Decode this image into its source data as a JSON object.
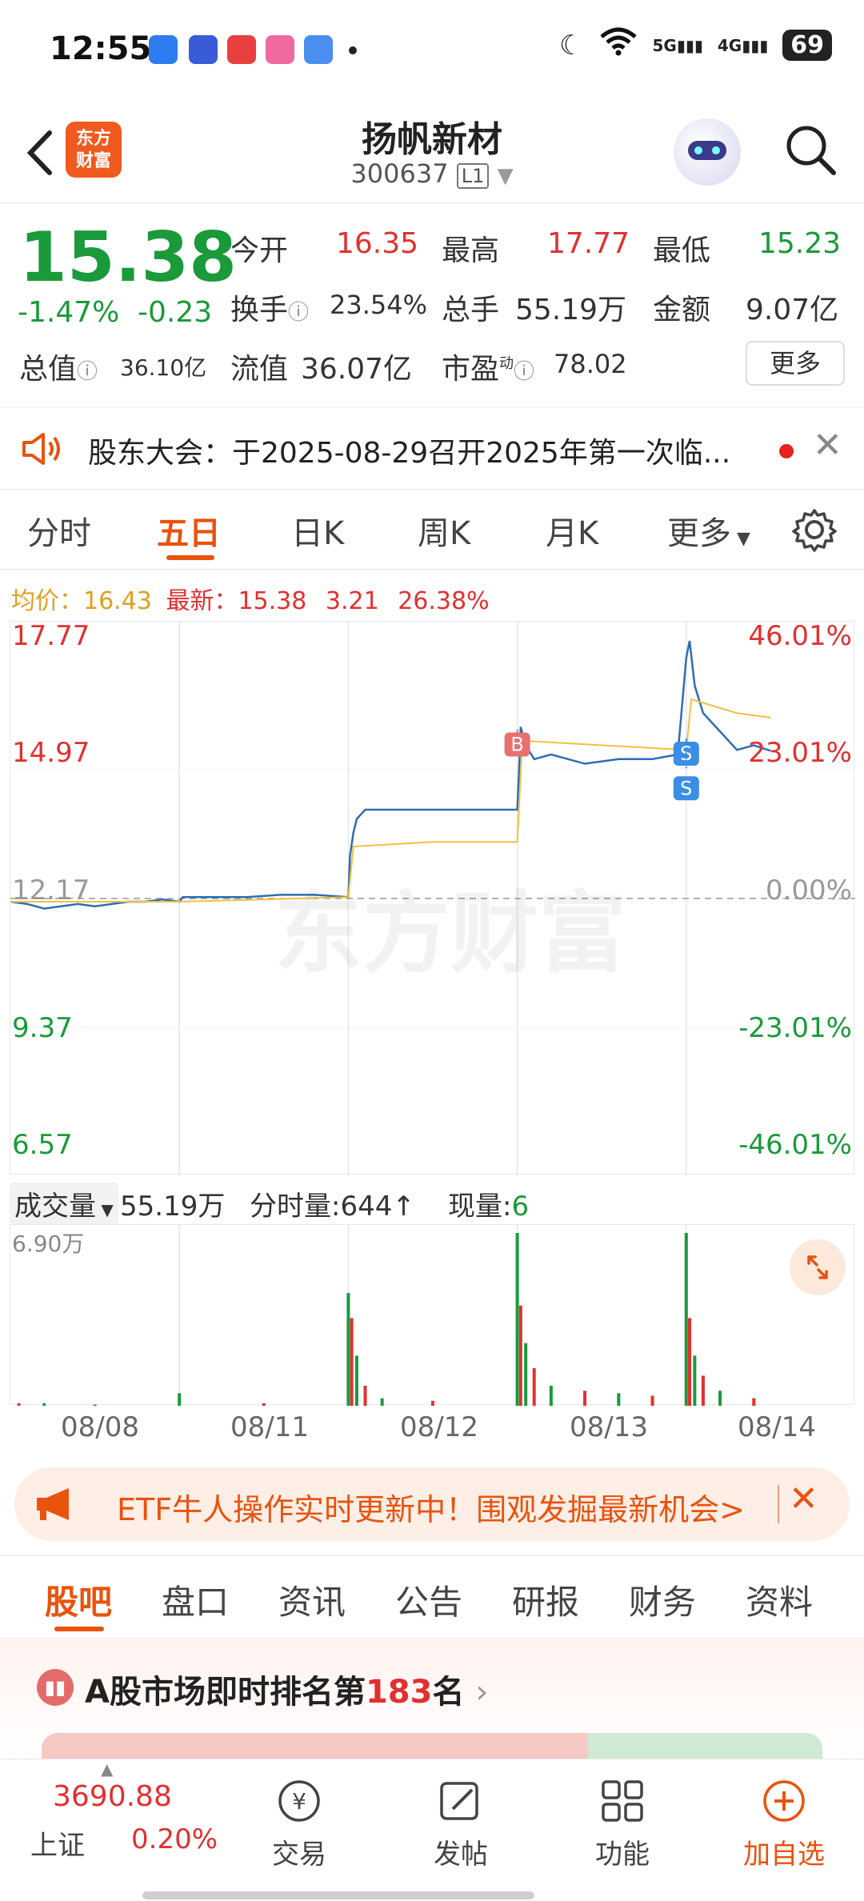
{
  "status_bar": {
    "time": "12:55",
    "battery": "69",
    "network_5g": "5G",
    "network_4g": "4G"
  },
  "header": {
    "logo_text_line1": "东方",
    "logo_text_line2": "财富",
    "title": "扬帆新材",
    "code": "300637",
    "board_tag": "L1"
  },
  "quote": {
    "price": "15.38",
    "change_pct": "-1.47%",
    "change_abs": "-0.23",
    "open_label": "今开",
    "open_value": "16.35",
    "high_label": "最高",
    "high_value": "17.77",
    "low_label": "最低",
    "low_value": "15.23",
    "turnover_label": "换手",
    "turnover_value": "23.54%",
    "volume_label": "总手",
    "volume_value": "55.19万",
    "amount_label": "金额",
    "amount_value": "9.07亿",
    "mktcap_label": "总值",
    "mktcap_value": "36.10亿",
    "float_label": "流值",
    "float_value": "36.07亿",
    "pe_label": "市盈",
    "pe_sup": "动",
    "pe_value": "78.02",
    "more_button": "更多"
  },
  "notice": {
    "text": "股东大会：于2025-08-29召开2025年第一次临..."
  },
  "chart_tabs": [
    "分时",
    "五日",
    "日K",
    "周K",
    "月K",
    "更多"
  ],
  "chart_legend": {
    "avg_label": "均价：",
    "avg_value": "16.43",
    "latest_label": "最新：",
    "latest_value": "15.38",
    "latest_change": "3.21",
    "latest_pct": "26.38%"
  },
  "chart_data": {
    "type": "line",
    "y_left_labels": [
      "17.77",
      "14.97",
      "12.17",
      "9.37",
      "6.57"
    ],
    "y_right_labels": [
      "46.01%",
      "23.01%",
      "0.00%",
      "-23.01%",
      "-46.01%"
    ],
    "ylim": [
      6.57,
      17.77
    ],
    "x_day_labels": [
      "08/08",
      "08/11",
      "08/12",
      "08/13",
      "08/14"
    ],
    "series": [
      {
        "name": "",
        "type": "price",
        "color": "#2f6db5",
        "x": [
          0,
          0.1,
          0.2,
          0.3,
          0.4,
          0.5,
          0.6,
          0.7,
          0.8,
          0.9,
          1.0,
          1.01,
          1.02,
          1.2,
          1.4,
          1.6,
          1.8,
          2.0,
          2.01,
          2.03,
          2.05,
          2.1,
          2.2,
          2.4,
          2.6,
          2.8,
          3.0,
          3.01,
          3.02,
          3.05,
          3.1,
          3.2,
          3.4,
          3.6,
          3.8,
          3.95,
          4.0,
          4.02,
          4.05,
          4.1,
          4.2,
          4.3,
          4.4,
          4.5
        ],
        "values": [
          12.1,
          12.05,
          11.95,
          12.0,
          12.05,
          12.0,
          12.05,
          12.1,
          12.1,
          12.15,
          12.1,
          12.15,
          12.2,
          12.2,
          12.2,
          12.25,
          12.25,
          12.2,
          13.1,
          13.6,
          13.9,
          14.1,
          14.1,
          14.1,
          14.1,
          14.1,
          14.1,
          14.9,
          15.9,
          15.5,
          15.2,
          15.3,
          15.1,
          15.2,
          15.2,
          15.3,
          17.4,
          17.77,
          16.8,
          16.2,
          15.8,
          15.4,
          15.5,
          15.38
        ]
      },
      {
        "name": "",
        "type": "average",
        "color": "#f0c040",
        "x": [
          0,
          1.0,
          2.0,
          2.03,
          2.5,
          3.0,
          3.03,
          3.5,
          4.0,
          4.03,
          4.3,
          4.5
        ],
        "values": [
          12.1,
          12.1,
          12.2,
          13.3,
          13.4,
          13.4,
          15.6,
          15.5,
          15.4,
          16.5,
          16.2,
          16.1
        ]
      }
    ],
    "markers": [
      {
        "label": "B",
        "x": 3.0,
        "value": 15.5,
        "color": "#e87070"
      },
      {
        "label": "S",
        "x": 4.0,
        "value": 15.3,
        "color": "#3a8ee6"
      },
      {
        "label": "S",
        "x": 4.0,
        "value": 15.0,
        "color": "#3a8ee6"
      }
    ],
    "grid": true,
    "watermark": "东方财富"
  },
  "volume": {
    "dropdown_label": "成交量",
    "total": "55.19万",
    "minute_label": "分时量:",
    "minute_value": "644",
    "current_label": "现量:",
    "current_value": "6",
    "y_max_label": "6.90万",
    "chart_data": {
      "type": "bar",
      "x": [
        0.05,
        0.2,
        0.5,
        1.0,
        1.5,
        2.0,
        2.02,
        2.05,
        2.1,
        2.2,
        2.5,
        3.0,
        3.02,
        3.05,
        3.1,
        3.2,
        3.4,
        3.6,
        3.8,
        4.0,
        4.02,
        4.05,
        4.1,
        4.2,
        4.4
      ],
      "values": [
        0.1,
        0.1,
        0.05,
        0.5,
        0.1,
        4.5,
        3.5,
        2.0,
        0.8,
        0.3,
        0.2,
        6.9,
        4.0,
        2.5,
        1.5,
        0.8,
        0.6,
        0.5,
        0.4,
        6.9,
        3.5,
        2.0,
        1.2,
        0.6,
        0.3
      ],
      "ylim": [
        0,
        6.9
      ],
      "colors": {
        "up": "#e23030",
        "down": "#1a9a3a"
      }
    }
  },
  "etf_banner": {
    "text": "ETF牛人操作实时更新中！围观发掘最新机会>"
  },
  "sub_tabs": [
    "股吧",
    "盘口",
    "资讯",
    "公告",
    "研报",
    "财务",
    "资料"
  ],
  "rank": {
    "prefix": "A股市场即时排名第",
    "number": "183",
    "suffix": "名"
  },
  "bottom_nav": {
    "index_value": "3690.88",
    "index_name": "上证",
    "index_pct": "0.20%",
    "items": [
      "交易",
      "发帖",
      "功能",
      "加自选"
    ]
  },
  "colors": {
    "up": "#e23030",
    "down": "#1a9a3a",
    "accent": "#e8530e"
  }
}
